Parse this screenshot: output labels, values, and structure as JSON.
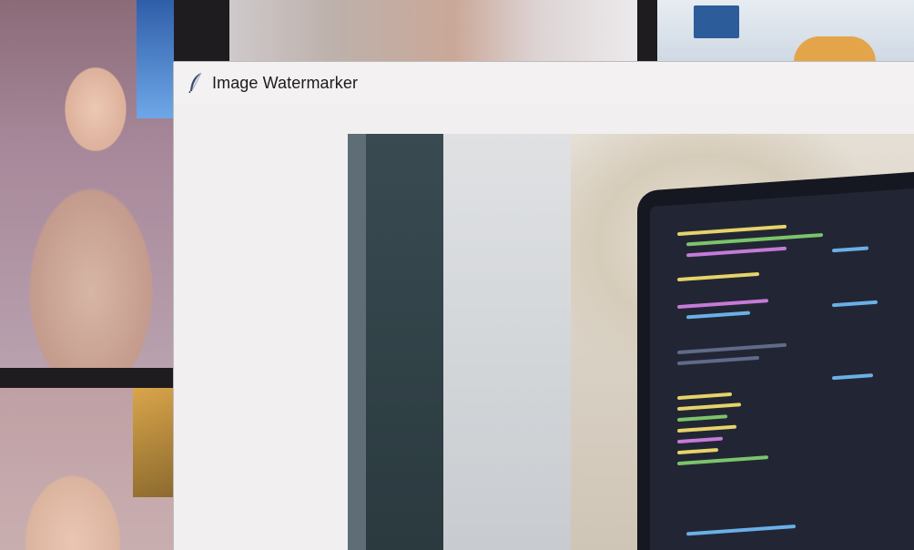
{
  "window": {
    "title": "Image Watermarker",
    "icon": "feather-icon"
  },
  "colors": {
    "title_bar": "#f3f1f1",
    "window_body": "#f1efef",
    "desktop_background": "#1e1c1f"
  }
}
